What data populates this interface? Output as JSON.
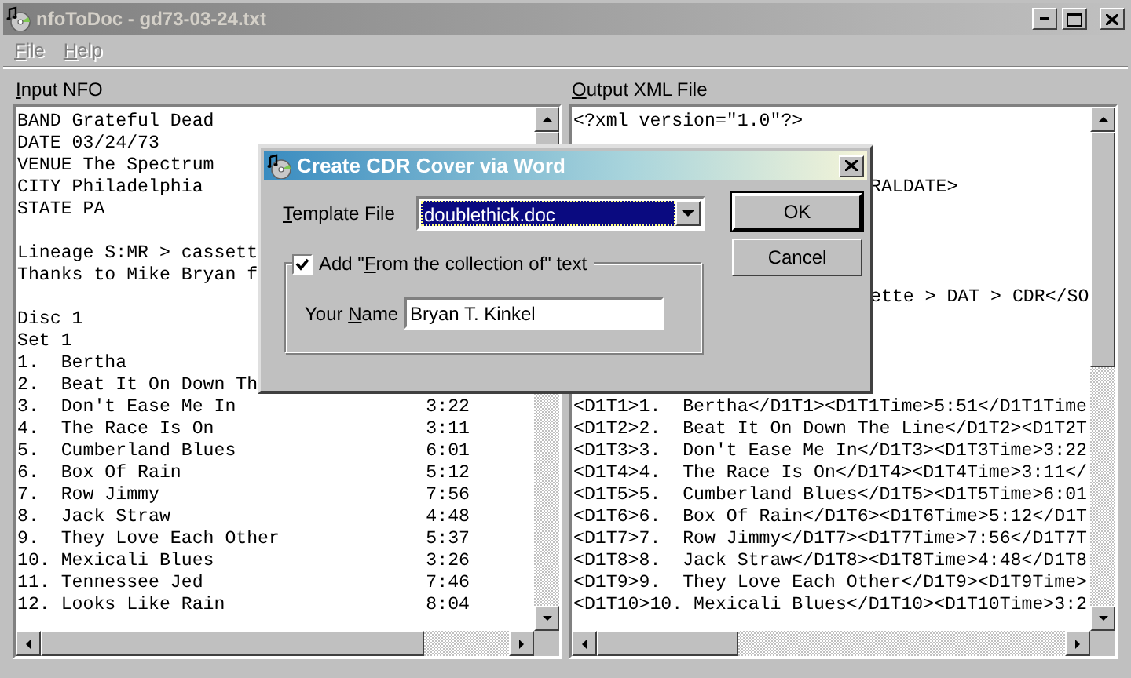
{
  "window": {
    "title": "nfoToDoc - gd73-03-24.txt",
    "active": false
  },
  "menu": [
    {
      "label": {
        "key": "F",
        "post": "ile"
      },
      "disabled": true
    },
    {
      "label": {
        "key": "H",
        "post": "elp"
      },
      "disabled": true
    }
  ],
  "input_pane": {
    "label": {
      "key": "I",
      "post": "nput NFO"
    },
    "lines": [
      {
        "kind": "text",
        "text": "BAND Grateful Dead"
      },
      {
        "kind": "text",
        "text": "DATE 03/24/73"
      },
      {
        "kind": "text",
        "text": "VENUE The Spectrum"
      },
      {
        "kind": "text",
        "text": "CITY Philadelphia"
      },
      {
        "kind": "text",
        "text": "STATE PA"
      },
      {
        "kind": "blank"
      },
      {
        "kind": "text",
        "text": "Lineage S:MR > cassett"
      },
      {
        "kind": "text",
        "text": "Thanks to Mike Bryan f"
      },
      {
        "kind": "blank"
      },
      {
        "kind": "text",
        "text": "Disc 1"
      },
      {
        "kind": "text",
        "text": "Set 1"
      },
      {
        "kind": "track",
        "text": "1.  Bertha"
      },
      {
        "kind": "track",
        "text": "2.  Beat It On Down Th"
      },
      {
        "kind": "track",
        "text": "3.  Don't Ease Me In",
        "time": "3:22"
      },
      {
        "kind": "track",
        "text": "4.  The Race Is On",
        "time": "3:11"
      },
      {
        "kind": "track",
        "text": "5.  Cumberland Blues",
        "time": "6:01"
      },
      {
        "kind": "track",
        "text": "6.  Box Of Rain",
        "time": "5:12"
      },
      {
        "kind": "track",
        "text": "7.  Row Jimmy",
        "time": "7:56"
      },
      {
        "kind": "track",
        "text": "8.  Jack Straw",
        "time": "4:48"
      },
      {
        "kind": "track",
        "text": "9.  They Love Each Other",
        "time": "5:37"
      },
      {
        "kind": "track",
        "text": "10. Mexicali Blues",
        "time": "3:26"
      },
      {
        "kind": "track",
        "text": "11. Tennessee Jed",
        "time": "7:46"
      },
      {
        "kind": "track",
        "text": "12. Looks Like Rain",
        "time": "8:04"
      }
    ]
  },
  "output_pane": {
    "label": {
      "key": "O",
      "post": "utput XML File"
    },
    "lines": [
      {
        "kind": "text",
        "text": "<?xml version=\"1.0\"?>"
      },
      {
        "kind": "blank"
      },
      {
        "kind": "blank"
      },
      {
        "kind": "clipped",
        "text": "RALDATE>"
      },
      {
        "kind": "blank"
      },
      {
        "kind": "blank"
      },
      {
        "kind": "blank"
      },
      {
        "kind": "blank"
      },
      {
        "kind": "clipped",
        "text": "ette > DAT > CDR</SO"
      },
      {
        "kind": "blank"
      },
      {
        "kind": "blank"
      },
      {
        "kind": "blank"
      },
      {
        "kind": "blank"
      },
      {
        "kind": "text",
        "text": "<D1T1>1.  Bertha</D1T1><D1T1Time>5:51</D1T1Time"
      },
      {
        "kind": "text",
        "text": "<D1T2>2.  Beat It On Down The Line</D1T2><D1T2T"
      },
      {
        "kind": "text",
        "text": "<D1T3>3.  Don't Ease Me In</D1T3><D1T3Time>3:22"
      },
      {
        "kind": "text",
        "text": "<D1T4>4.  The Race Is On</D1T4><D1T4Time>3:11</"
      },
      {
        "kind": "text",
        "text": "<D1T5>5.  Cumberland Blues</D1T5><D1T5Time>6:01"
      },
      {
        "kind": "text",
        "text": "<D1T6>6.  Box Of Rain</D1T6><D1T6Time>5:12</D1T"
      },
      {
        "kind": "text",
        "text": "<D1T7>7.  Row Jimmy</D1T7><D1T7Time>7:56</D1T7T"
      },
      {
        "kind": "text",
        "text": "<D1T8>8.  Jack Straw</D1T8><D1T8Time>4:48</D1T8"
      },
      {
        "kind": "text",
        "text": "<D1T9>9.  They Love Each Other</D1T9><D1T9Time>"
      },
      {
        "kind": "text",
        "text": "<D1T10>10. Mexicali Blues</D1T10><D1T10Time>3:2"
      }
    ]
  },
  "dialog": {
    "title": "Create CDR Cover via Word",
    "active": true,
    "template_label": {
      "key": "T",
      "post": "emplate File"
    },
    "template_value": "doublethick.doc",
    "checkbox": {
      "label": {
        "pre": "Add \"",
        "key": "F",
        "post": "rom the collection of\" text"
      },
      "checked": true
    },
    "name_label": {
      "pre": "Your ",
      "key": "N",
      "post": "ame"
    },
    "name_value": "Bryan T. Kinkel",
    "buttons": [
      {
        "label": "OK",
        "default": true
      },
      {
        "label": "Cancel",
        "default": false
      }
    ]
  }
}
